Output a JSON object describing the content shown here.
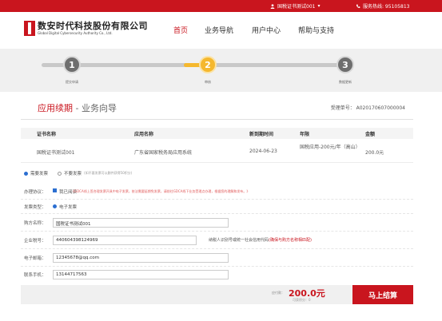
{
  "topbar": {
    "user_label": "国税证书测试001",
    "dropdown_glyph": "▾",
    "hotline": "服务热线: 95105813",
    "bg_color": "#c9151e"
  },
  "brand": {
    "name_cn": "数安时代科技股份有限公司",
    "name_en": "Global Digital Cybersecurity Authority Co., Ltd."
  },
  "nav": {
    "items": [
      "首页",
      "业务导航",
      "用户中心",
      "帮助与支持"
    ],
    "active_index": 0
  },
  "steps": [
    {
      "number": "1",
      "label": "提交申请",
      "state": "done"
    },
    {
      "number": "2",
      "label": "审核",
      "state": "active"
    },
    {
      "number": "3",
      "label": "数据更新",
      "state": "pending"
    }
  ],
  "page": {
    "title_highlight": "应用续期",
    "title_rest": " - 业务向导",
    "order_no": "受理单号： A020170607000004"
  },
  "table": {
    "headers": [
      "证书名称",
      "应用名称",
      "新到期时间",
      "年限",
      "金额"
    ],
    "rows": [
      [
        "国税证书测试001",
        "广东省国家税务局应用系统",
        "2024-06-23",
        "国税应用-200元/年（高山）",
        "200.0元"
      ]
    ]
  },
  "invoice": {
    "need_label": "需要发票",
    "no_need_label": "不要发票",
    "no_need_note": "(如不要发票可以删件获得50积分)",
    "selected": "need"
  },
  "form": {
    "agreement_label": "办理协议：",
    "agreement_check": "我已阅读",
    "agreement_note": "《GDCA线上签合理发票开具中电子发票，依法需要延期免发票，请前往GDCA线下业务受理点办理，根据您的理解和发布。》",
    "invoice_type_label": "发票类型：",
    "invoice_type_value": "电子发票",
    "buyer_label": "购方名称：",
    "buyer_value": "国税证书测试001",
    "taxid_label": "企业税号：",
    "taxid_value": "440604398124969",
    "taxid_note": "纳税人识别号或统一社会信用代码",
    "taxid_note_red": "(确保与购方名称相匹配)",
    "email_label": "电子邮箱：",
    "email_value": "12345678@qq.com",
    "phone_label": "联系手机：",
    "phone_value": "13144717563"
  },
  "footer": {
    "total_label": "应付款：",
    "total_value": "200.0元",
    "total_sub": "可获积分：0",
    "pay_button": "马上结算"
  },
  "colors": {
    "accent": "#c9151e",
    "step_done": "#6e6e6e",
    "step_active": "#f5b82e",
    "step_pending": "#6e6e6e",
    "track_gray": "#c8c8c8",
    "track_gold": "#f5b82e"
  }
}
